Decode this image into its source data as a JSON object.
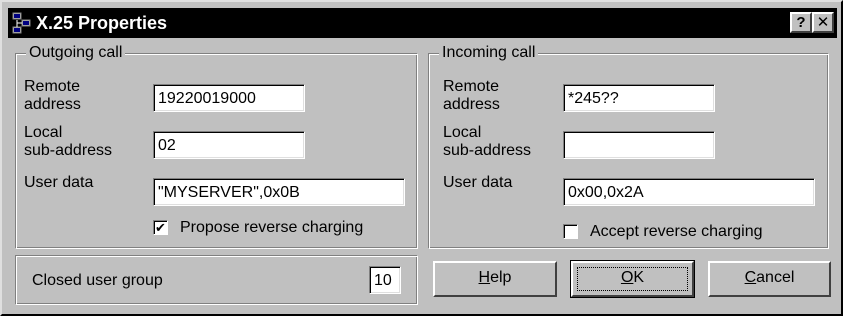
{
  "window": {
    "title": "X.25 Properties",
    "icon": "network-dialog-icon",
    "help_glyph": "?",
    "close_glyph": "✕"
  },
  "outgoing": {
    "legend": "Outgoing call",
    "remote_address_label_1": "Remote",
    "remote_address_label_2": "address",
    "remote_address_value": "19220019000",
    "local_subaddress_label_1": "Local",
    "local_subaddress_label_2": "sub-address",
    "local_subaddress_value": "02",
    "user_data_label": "User data",
    "user_data_value": "\"MYSERVER\",0x0B",
    "reverse_charging_label": "Propose reverse charging",
    "reverse_charging_checked": true,
    "check_glyph": "✔"
  },
  "incoming": {
    "legend": "Incoming call",
    "remote_address_label_1": "Remote",
    "remote_address_label_2": "address",
    "remote_address_value": "*245??",
    "local_subaddress_label_1": "Local",
    "local_subaddress_label_2": "sub-address",
    "local_subaddress_value": "",
    "user_data_label": "User data",
    "user_data_value": "0x00,0x2A",
    "reverse_charging_label": "Accept reverse charging",
    "reverse_charging_checked": false
  },
  "closed_user_group": {
    "label": "Closed user group",
    "value": "10"
  },
  "buttons": {
    "help_mnemonic": "H",
    "help_rest": "elp",
    "ok_mnemonic": "O",
    "ok_rest": "K",
    "cancel_mnemonic": "C",
    "cancel_rest": "ancel"
  }
}
